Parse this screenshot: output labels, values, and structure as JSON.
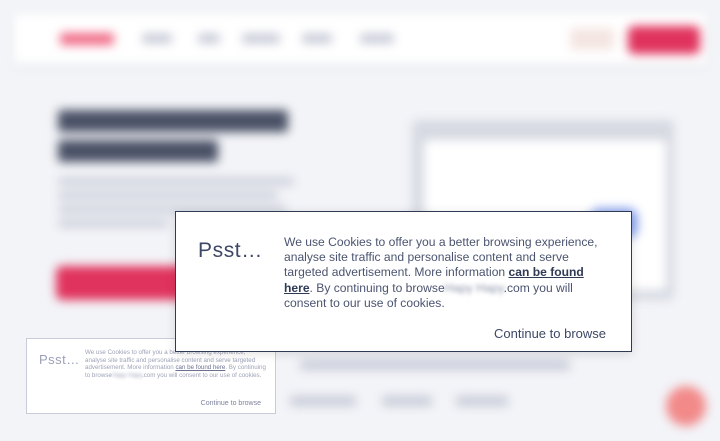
{
  "dialog": {
    "title": "Psst…",
    "body_part1": "We use Cookies to offer you a better browsing experience, analyse site traffic and personalise content and serve targeted advertisement. More information ",
    "link_text": "can be found here",
    "body_part2": ". By continuing to browse",
    "site_redacted": "Hapy Hapy",
    "body_part3": ".com you will consent to our use of cookies.",
    "button": "Continue to browse"
  },
  "small_card": {
    "title": "Psst…",
    "body_part1": "We use Cookies to offer you a better browsing experience, analyse site traffic and personalise content and serve targeted advertisement. More information ",
    "link_text": "can be found here",
    "body_part2": ". By continuing to browse",
    "site_redacted": "Hapy Hapy",
    "body_part3": ".com you will consent to our use of cookies.",
    "button": "Continue to browse"
  },
  "colors": {
    "accent": "#e0335d",
    "dialog_border": "#2f3a55",
    "text": "#4b5470"
  }
}
